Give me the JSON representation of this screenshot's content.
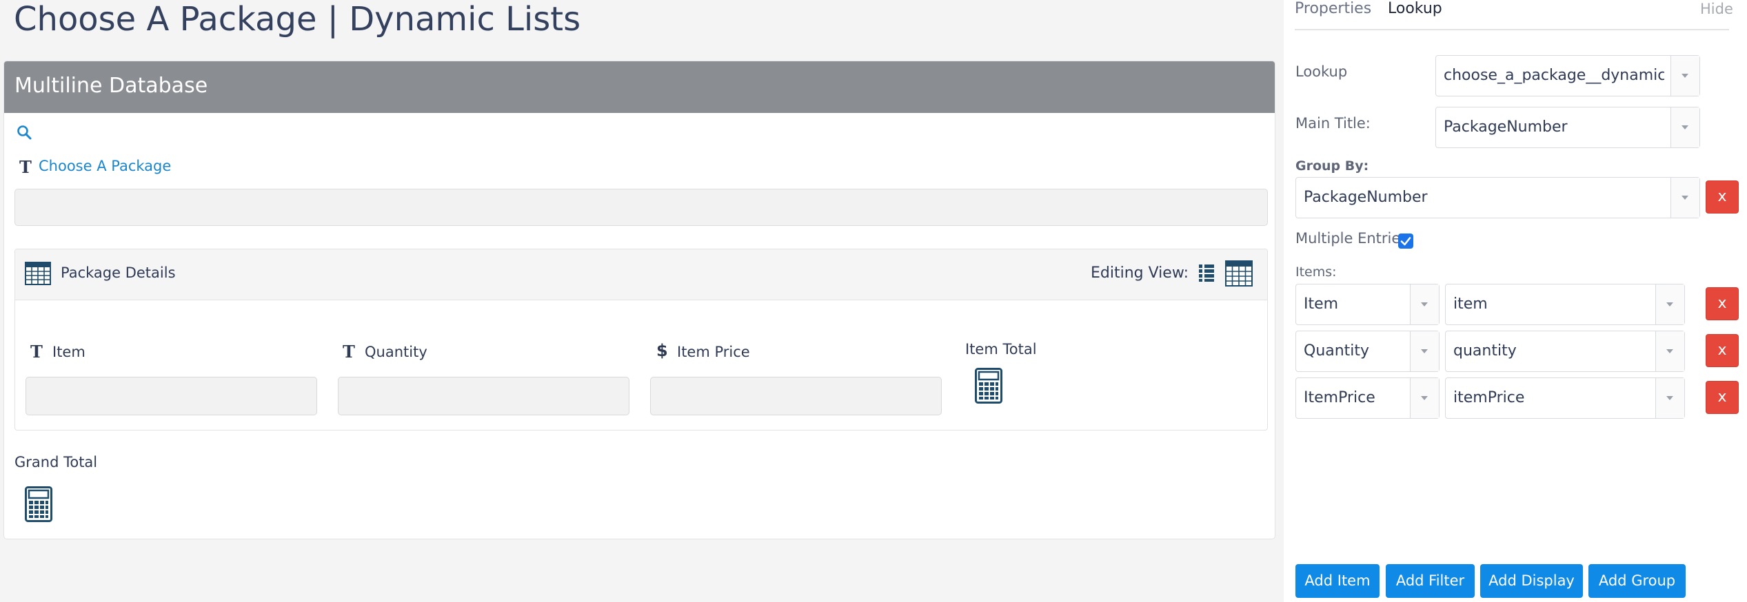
{
  "page": {
    "title": "Choose A Package | Dynamic Lists"
  },
  "form": {
    "section_title": "Multiline Database",
    "choose_package_label": "Choose A Package",
    "choose_package_value": "",
    "package_details": {
      "title": "Package Details",
      "editing_view_label": "Editing View:",
      "columns": [
        {
          "label": "Item",
          "type_icon": "text-icon",
          "value": ""
        },
        {
          "label": "Quantity",
          "type_icon": "text-icon",
          "value": ""
        },
        {
          "label": "Item Price",
          "type_icon": "dollar-icon",
          "value": ""
        },
        {
          "label": "Item Total",
          "type_icon": "calculator-icon"
        }
      ]
    },
    "grand_total_label": "Grand Total"
  },
  "panel": {
    "tabs": [
      {
        "label": "Properties",
        "active": false
      },
      {
        "label": "Lookup",
        "active": true
      }
    ],
    "hide_label": "Hide",
    "lookup": {
      "label": "Lookup",
      "value": "choose_a_package__dynamic_..."
    },
    "main_title": {
      "label": "Main Title:",
      "value": "PackageNumber"
    },
    "group_by": {
      "label": "Group By:",
      "value": "PackageNumber",
      "remove_label": "x"
    },
    "multiple_entries": {
      "label": "Multiple Entries:",
      "checked": true
    },
    "items_label": "Items:",
    "items": [
      {
        "field": "Item",
        "value": "item",
        "remove_label": "x"
      },
      {
        "field": "Quantity",
        "value": "quantity",
        "remove_label": "x"
      },
      {
        "field": "ItemPrice",
        "value": "itemPrice",
        "remove_label": "x"
      }
    ],
    "buttons": {
      "add_item": "Add Item",
      "add_filter": "Add Filter",
      "add_display": "Add Display",
      "add_group": "Add Group"
    }
  },
  "colors": {
    "header_gray": "#8a8d91",
    "link_blue": "#1a86d0",
    "button_blue": "#0f8ae6",
    "remove_red": "#e5473b",
    "icon_navy": "#1f4c6b"
  }
}
